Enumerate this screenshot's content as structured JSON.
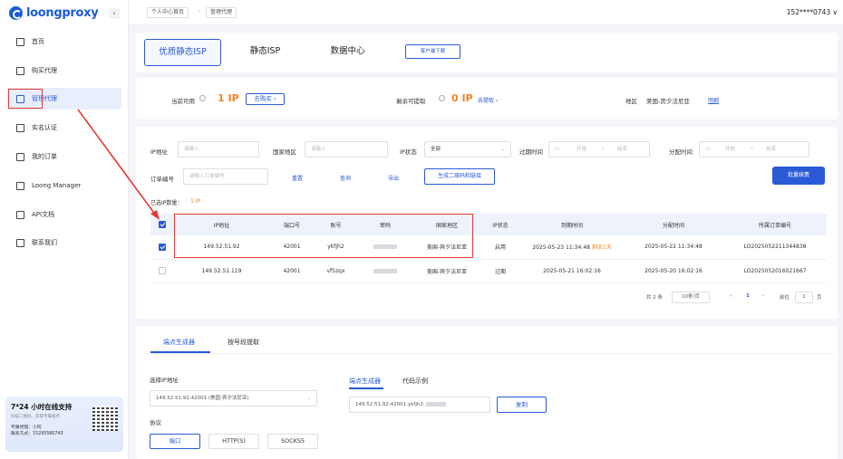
{
  "sidebar": {
    "logo": "loongproxy",
    "collapse": "‹",
    "items": [
      {
        "label": "首页",
        "icon": "grid-icon"
      },
      {
        "label": "购买代理",
        "icon": "bag-icon"
      },
      {
        "label": "管理代理",
        "icon": "folder-icon"
      },
      {
        "label": "实名认证",
        "icon": "id-scan-icon"
      },
      {
        "label": "我的订单",
        "icon": "order-icon"
      },
      {
        "label": "Loong Manager",
        "icon": "window-icon"
      },
      {
        "label": "API文档",
        "icon": "code-icon"
      },
      {
        "label": "联系我们",
        "icon": "contact-icon"
      }
    ],
    "support": {
      "title": "7*24 小时在线支持",
      "subtitle": "扫描二维码，获取专属服务",
      "manager": "专属经理：小冈",
      "contact": "联系方式：15295580743"
    }
  },
  "topbar": {
    "crumbs": [
      "个人中心首页",
      "管理代理"
    ],
    "user": "152****0743 ∨"
  },
  "type_tabs": [
    "优质静态ISP",
    "静态ISP",
    "数据中心"
  ],
  "client_download": "客户端下载",
  "summary": {
    "available_label": "当前可用",
    "available_value": "1 IP",
    "buy": "去购买 ›",
    "remaining_label": "剩余可提取",
    "remaining_value": "0 IP",
    "extract": "去提取 ›",
    "region_label": "地区",
    "region_value": "美国-宾夕法尼亚",
    "region_detail": "明细"
  },
  "filters": {
    "ip_label": "IP地址",
    "ip_placeholder": "请输入",
    "country_label": "国家地区",
    "country_placeholder": "请输入",
    "status_label": "IP状态",
    "status_value": "全部",
    "expire_label": "过期时间",
    "start": "开始",
    "tilde": "~",
    "end": "结束",
    "assign_label": "分配时间",
    "order_label": "订单编号",
    "order_placeholder": "请输入订单编号",
    "reset": "重置",
    "query": "查询",
    "export": "导出",
    "qr": "生成二维码和链接",
    "batch_renew": "批量续费"
  },
  "selected": {
    "label": "已选IP数量：",
    "value": "1 IP"
  },
  "table": {
    "headers": [
      "IP地址",
      "端口号",
      "账号",
      "密码",
      "国家地区",
      "IP状态",
      "到期时间",
      "分配时间",
      "所属订单编号"
    ],
    "rows": [
      {
        "ip": "149.52.51.92",
        "port": "42001",
        "account": "ykfjh2",
        "region": "美国-宾夕法尼亚",
        "status": "启用",
        "expire": "2025-05-23 11:34:48",
        "expire_note": "剩余1天",
        "assigned": "2025-05-22 11:34:48",
        "order": "LO2025052211344838"
      },
      {
        "ip": "149.52.51.119",
        "port": "42001",
        "account": "vf5zqx",
        "region": "美国-宾夕法尼亚",
        "status": "过期",
        "expire": "2025-05-21 16:02:16",
        "expire_note": "",
        "assigned": "2025-05-20 16:02:16",
        "order": "LO2025052016021667"
      }
    ]
  },
  "pagination": {
    "total": "共 2 条",
    "page_size": "10条/页",
    "prev": "‹",
    "current": "1",
    "next": "›",
    "goto": "前往",
    "page": "1",
    "unit": "页"
  },
  "generator": {
    "tabs": [
      "端点生成器",
      "按号段提取"
    ],
    "select_ip_label": "选择IP地址",
    "select_ip_value": "149.52.51.92:42001 (美国-宾夕法尼亚)",
    "protocol_label": "协议",
    "protocols": [
      "端口",
      "HTTP(S)",
      "SOCKS5"
    ],
    "inner_tabs": [
      "端点生成器",
      "代码示例"
    ],
    "endpoint": "149.52.51.92:42001:ykfjh2:",
    "copy": "复制"
  }
}
